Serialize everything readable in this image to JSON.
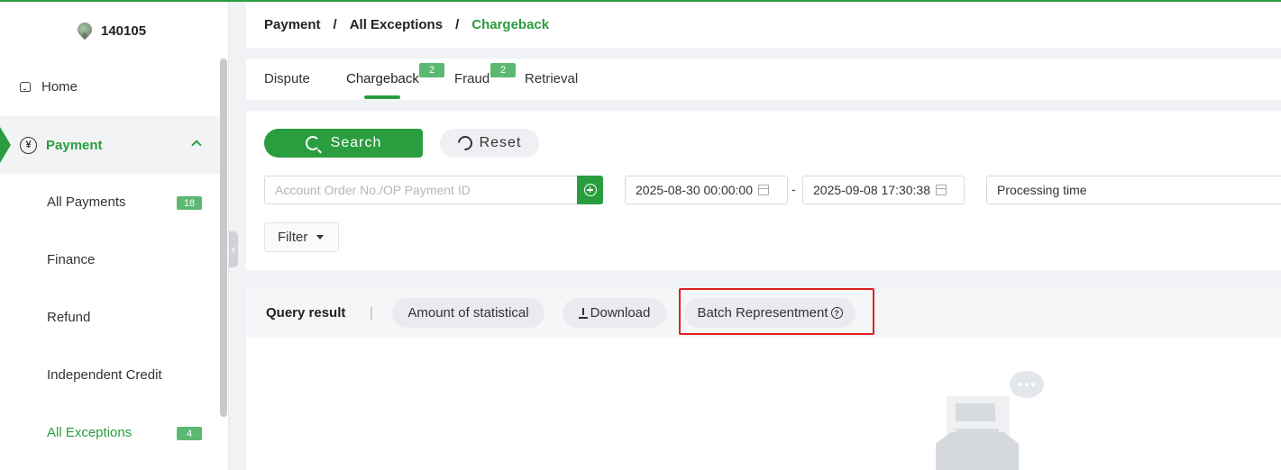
{
  "merchant": {
    "id": "140105"
  },
  "sidebar": {
    "home": "Home",
    "payment": "Payment",
    "items": [
      {
        "label": "All Payments",
        "badge": "18"
      },
      {
        "label": "Finance"
      },
      {
        "label": "Refund"
      },
      {
        "label": "Independent Credit"
      },
      {
        "label": "All Exceptions",
        "badge": "4"
      }
    ]
  },
  "breadcrumb": {
    "first": "Payment",
    "second": "All Exceptions",
    "current": "Chargeback",
    "separator": "/"
  },
  "tabs": [
    {
      "label": "Dispute"
    },
    {
      "label": "Chargeback",
      "badge": "2"
    },
    {
      "label": "Fraud",
      "badge": "2"
    },
    {
      "label": "Retrieval"
    }
  ],
  "search": {
    "search_label": "Search",
    "reset_label": "Reset",
    "order_placeholder": "Account Order No./OP Payment ID",
    "date_start": "2025-08-30 00:00:00",
    "date_end": "2025-09-08 17:30:38",
    "date_dash": "-",
    "time_type": "Processing time",
    "filter_label": "Filter"
  },
  "results": {
    "title": "Query result",
    "separator": "|",
    "amount_label": "Amount of statistical",
    "download_label": "Download",
    "batch_label": "Batch Representment",
    "help_mark": "?"
  },
  "colors": {
    "accent": "#2a9d3f",
    "badge": "#5cb870",
    "highlight": "#e02020"
  }
}
